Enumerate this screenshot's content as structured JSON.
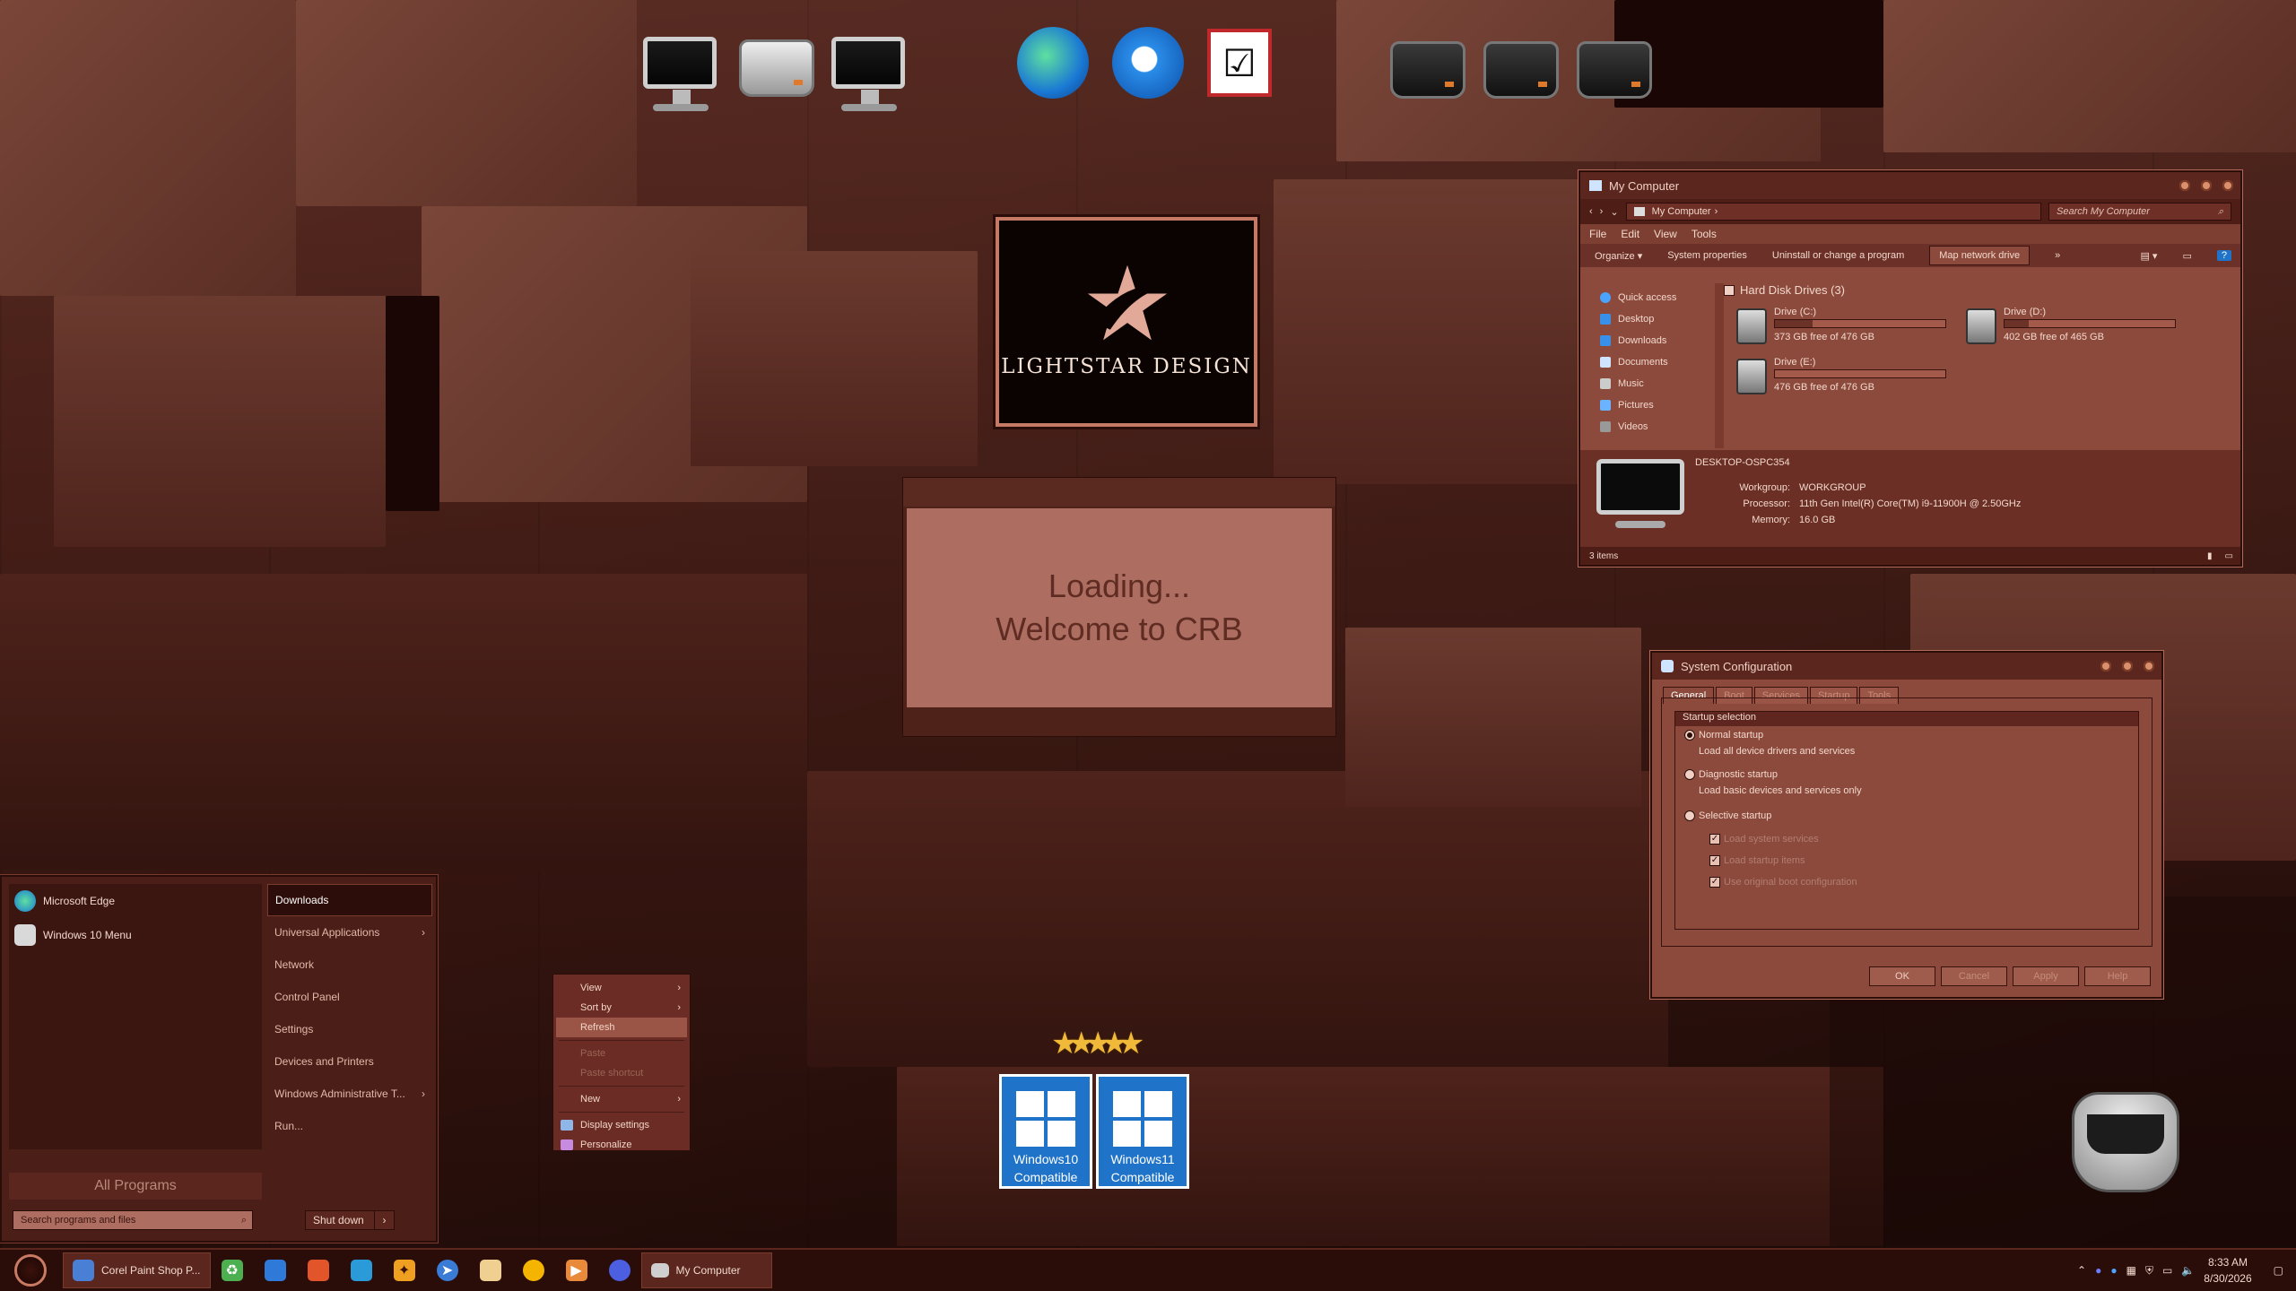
{
  "colors": {
    "accent": "#8c4a3d",
    "dark": "#2a0d09",
    "badge_blue": "#1f73c8"
  },
  "desktop_icons": {
    "top_left": [
      "monitor-icon",
      "media-player-icon",
      "satellite-dish-icon"
    ],
    "top_center": [
      "edge-eagle-icon",
      "thunderbird-icon",
      "checklist-icon"
    ],
    "top_right": [
      "drive-icon",
      "drive-icon",
      "drive-icon"
    ]
  },
  "logo": {
    "text": "LIGHTSTAR DESIGN"
  },
  "loading": {
    "line1": "Loading...",
    "line2": "Welcome to CRB"
  },
  "mycomputer": {
    "title": "My Computer",
    "address": "My Computer",
    "search_placeholder": "Search My Computer",
    "menu": [
      "File",
      "Edit",
      "View",
      "Tools"
    ],
    "commands": [
      "Organize",
      "System properties",
      "Uninstall or change a program",
      "Map network drive"
    ],
    "nav": [
      "Quick access",
      "Desktop",
      "Downloads",
      "Documents",
      "Music",
      "Pictures",
      "Videos"
    ],
    "group": "Hard Disk Drives (3)",
    "drives": [
      {
        "name": "Drive (C:)",
        "free": "373 GB free of 476 GB",
        "used": 0.22
      },
      {
        "name": "Drive (D:)",
        "free": "402 GB free of 465 GB",
        "used": 0.14
      },
      {
        "name": "Drive (E:)",
        "free": "476 GB free of 476 GB",
        "used": 0.0
      }
    ],
    "pc_name": "DESKTOP-OSPC354",
    "details": [
      {
        "k": "Workgroup:",
        "v": "WORKGROUP"
      },
      {
        "k": "Processor:",
        "v": "11th Gen Intel(R) Core(TM) i9-11900H @ 2.50GHz"
      },
      {
        "k": "Memory:",
        "v": "16.0 GB"
      }
    ],
    "status": "3 items"
  },
  "msconfig": {
    "title": "System Configuration",
    "tabs": [
      "General",
      "Boot",
      "Services",
      "Startup",
      "Tools"
    ],
    "legend": "Startup selection",
    "normal": "Normal startup",
    "normal_desc": "Load all device drivers and services",
    "diag": "Diagnostic startup",
    "diag_desc": "Load basic devices and services only",
    "selective": "Selective startup",
    "checks": [
      "Load system services",
      "Load startup items",
      "Use original boot configuration"
    ],
    "buttons": [
      "OK",
      "Cancel",
      "Apply",
      "Help"
    ]
  },
  "startmenu": {
    "pinned": [
      "Microsoft Edge",
      "Windows 10 Menu"
    ],
    "right": [
      "Downloads",
      "Universal Applications",
      "Network",
      "Control Panel",
      "Settings",
      "Devices and Printers",
      "Windows Administrative T...",
      "Run..."
    ],
    "all_programs": "All Programs",
    "search_placeholder": "Search programs and files",
    "shutdown": "Shut down"
  },
  "context": {
    "items": [
      "View",
      "Sort by",
      "Refresh",
      "Paste",
      "Paste shortcut",
      "New",
      "Display settings",
      "Personalize"
    ]
  },
  "badges": [
    {
      "line1": "Windows10",
      "line2": "Compatible"
    },
    {
      "line1": "Windows11",
      "line2": "Compatible"
    }
  ],
  "taskbar": {
    "app1": "Corel Paint Shop P...",
    "app2": "My Computer",
    "time": "8:33 AM",
    "date": "8/30/2026"
  }
}
